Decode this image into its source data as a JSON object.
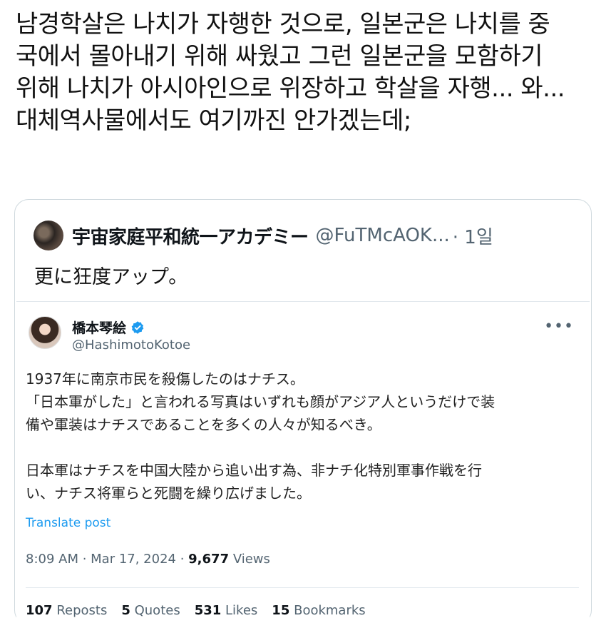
{
  "post": {
    "text": "남경학살은 나치가 자행한 것으로, 일본군은 나치를 중\n국에서 몰아내기 위해 싸웠고 그런 일본군을 모함하기\n위해 나치가 아시아인으로 위장하고 학살을 자행... 와...\n대체역사물에서도 여기까진 안가겠는데;"
  },
  "quote": {
    "name": "宇宙家庭平和統一アカデミー",
    "handle": "@FuTMcAOK...",
    "time": "· 1일",
    "text": "更に狂度アップ。",
    "inner": {
      "name": "橋本琴絵",
      "handle": "@HashimotoKotoe",
      "body": "1937年に南京市民を殺傷したのはナチス。\n「日本軍がした」と言われる写真はいずれも顔がアジア人というだけで装\n備や軍装はナチスであることを多くの人々が知るべき。\n\n日本軍はナチスを中国大陸から追い出す為、非ナチ化特別軍事作戦を行\nい、ナチス将軍らと死闘を繰り広げました。",
      "translate": "Translate post",
      "timestamp": "8:09 AM · Mar 17, 2024 · ",
      "views_count": "9,677",
      "views_label": " Views",
      "stats": [
        {
          "count": "107",
          "label": "Reposts"
        },
        {
          "count": "5",
          "label": "Quotes"
        },
        {
          "count": "531",
          "label": "Likes"
        },
        {
          "count": "15",
          "label": "Bookmarks"
        }
      ]
    }
  },
  "colors": {
    "link": "#1d9bf0",
    "muted": "#536471",
    "border": "#cfd9de"
  },
  "icons": {
    "verified": "verified-badge-icon",
    "more": "more-icon"
  }
}
